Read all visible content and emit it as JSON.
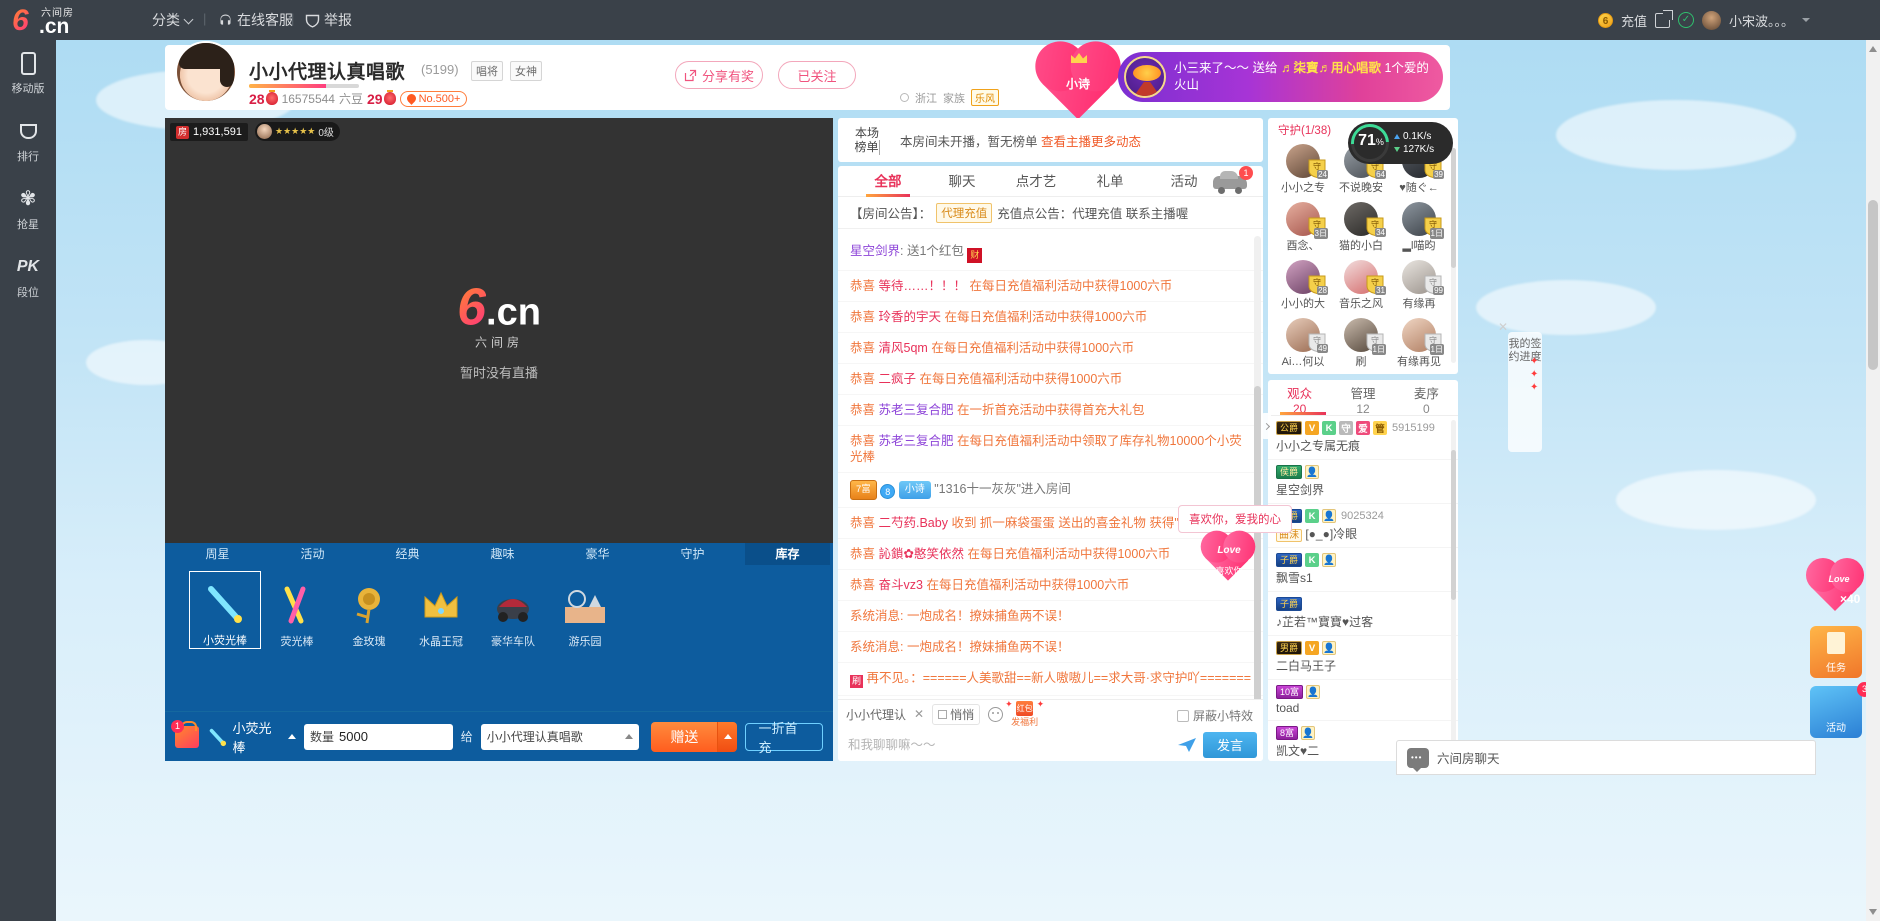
{
  "topnav": {
    "logo_main": "6",
    "logo_cn": ".cn",
    "logo_top": "六间房",
    "category": "分类",
    "support": "在线客服",
    "report": "举报",
    "recharge": "充值",
    "coin_glyph": "6",
    "username": "小宋波。。。"
  },
  "rail": [
    {
      "label": "移动版",
      "icon": "phone-icon"
    },
    {
      "label": "排行",
      "icon": "trophy-icon"
    },
    {
      "label": "抢星",
      "icon": "star-icon"
    },
    {
      "label": "段位",
      "icon": "pk-icon"
    }
  ],
  "anchor": {
    "name": "小小代理认真唱歌",
    "room_id": "(5199)",
    "tag1": "唱将",
    "tag2": "女神",
    "level_left": "28",
    "coins": "16575544",
    "coins_unit": "六豆",
    "level_right": "29",
    "rank_badge": "No.500+",
    "share_btn": "分享有奖",
    "follow_btn": "已关注",
    "location": "浙江",
    "family_label": "家族",
    "family_name": "乐风",
    "gift_heart_label": "小诗",
    "event_text_a": "小三来了～～ 送给 ",
    "event_text_b": "♬柒寶♬用心唱歌",
    "event_text_c": " 1个爱的火山"
  },
  "video": {
    "pop_count": "1,931,591",
    "pop_icon_text": "房",
    "level_pill": "0级",
    "watermark_6": "6",
    "watermark_cn": ".cn",
    "watermark_sub": "六间房",
    "offline_text": "暂时没有直播"
  },
  "giftbar": {
    "tabs": [
      "周星",
      "活动",
      "经典",
      "趣味",
      "豪华",
      "守护",
      "库存"
    ],
    "active_tab": "库存",
    "gifts": [
      {
        "name": "小荧光棒",
        "selected": true
      },
      {
        "name": "荧光棒",
        "selected": false
      },
      {
        "name": "金玫瑰",
        "selected": false
      },
      {
        "name": "水晶王冠",
        "selected": false
      },
      {
        "name": "豪华车队",
        "selected": false
      },
      {
        "name": "游乐园",
        "selected": false
      }
    ],
    "selected_gift": "小荧光棒",
    "bag_badge": "1",
    "qty_label": "数量",
    "qty_value": "5000",
    "to_label": "给",
    "to_value": "小小代理认真唱歌",
    "send_btn": "赠送",
    "recharge_btn": "一折首充"
  },
  "rank": {
    "left_line1": "本场",
    "left_line2": "榜单",
    "message": "本房间未开播，暂无榜单",
    "link": "查看主播更多动态"
  },
  "chat": {
    "tabs": [
      "全部",
      "聊天",
      "点才艺",
      "礼单",
      "活动"
    ],
    "active_tab": "全部",
    "car_badge": "1",
    "notice_prefix": "【房间公告】：",
    "notice_tag": "代理充值",
    "notice_text": "充值点公告：代理充值 联系主播喔",
    "messages": [
      {
        "type": "gift",
        "name": "星空剑界",
        "name_color": "purple",
        "text": ": 送1个红包",
        "badge": "财"
      },
      {
        "type": "congrats",
        "prefix": "恭喜",
        "name": "等待……！！！",
        "text": "在每日充值福利活动中获得1000六币"
      },
      {
        "type": "congrats",
        "prefix": "恭喜",
        "name": "玲香的宇天",
        "text": "在每日充值福利活动中获得1000六币"
      },
      {
        "type": "congrats",
        "prefix": "恭喜",
        "name": "清风5qm",
        "text": "在每日充值福利活动中获得1000六币"
      },
      {
        "type": "congrats",
        "prefix": "恭喜",
        "name": "二疯子",
        "text": "在每日充值福利活动中获得1000六币"
      },
      {
        "type": "congrats",
        "prefix": "恭喜",
        "name": "苏老三复合肥",
        "text": "在一折首充活动中获得首充大礼包"
      },
      {
        "type": "congrats",
        "prefix": "恭喜",
        "name": "苏老三复合肥",
        "text": "在每日充值福利活动中领取了库存礼物10000个小荧光棒"
      },
      {
        "type": "enter",
        "noble": "7富",
        "level": "8",
        "pill": "小诗",
        "text": "\"1316十一灰灰\"进入房间"
      },
      {
        "type": "congrats",
        "prefix": "恭喜",
        "name": "二芍药.Baby",
        "text": "收到 抓一麻袋蛋蛋 送出的喜金礼物 获得\"百花仙子\""
      },
      {
        "type": "congrats",
        "prefix": "恭喜",
        "name": "訫鎖✿憨笑依然",
        "text": "在每日充值福利活动中获得1000六币"
      },
      {
        "type": "congrats",
        "prefix": "恭喜",
        "name": "奋斗vz3",
        "text": "在每日充值福利活动中获得1000六币"
      },
      {
        "type": "system",
        "text": "系统消息: 一炮成名！撩妹捕鱼两不误！"
      },
      {
        "type": "system",
        "text": "系统消息: 一炮成名！撩妹捕鱼两不误！"
      },
      {
        "type": "badge_msg",
        "badge": "刷",
        "text": "再不见。：======人美歌甜==新人嗷嗷儿==求大哥·求守护吖======="
      }
    ],
    "input": {
      "sender": "小小代理认",
      "qq_label": "悄悄",
      "fuli_label": "发福利",
      "fuli_icon": "红包",
      "shield_label": "屏蔽小特效",
      "placeholder": "和我聊聊嘛～～",
      "post_btn": "发言"
    }
  },
  "guardians": {
    "title": "守护",
    "count": "(1/38)",
    "items": [
      {
        "name": "小小之专",
        "lvl": "24"
      },
      {
        "name": "不说晚安",
        "lvl": "64"
      },
      {
        "name": "♥随ぐ←",
        "lvl": "39"
      },
      {
        "name": "酉念、",
        "lvl": "3日"
      },
      {
        "name": "猫的小白",
        "lvl": "34"
      },
      {
        "name": "▂l喵昀",
        "lvl": "1日"
      },
      {
        "name": "小小的大",
        "lvl": "28"
      },
      {
        "name": "音乐之风",
        "lvl": "31"
      },
      {
        "name": "有缘再",
        "lvl": "99"
      },
      {
        "name": "Ai…何以",
        "lvl": "49"
      },
      {
        "name": "刷",
        "lvl": "1日"
      },
      {
        "name": "有缘再见",
        "lvl": "1日"
      }
    ]
  },
  "viewers": {
    "tabs": [
      {
        "label": "观众",
        "count": "20",
        "active": true
      },
      {
        "label": "管理",
        "count": "12",
        "active": false
      },
      {
        "label": "麦序",
        "count": "0",
        "active": false
      }
    ],
    "rows": [
      {
        "noble": "公爵",
        "noble_style": "noble",
        "badges": [
          "V",
          "K",
          "守",
          "爱",
          "管"
        ],
        "id": "5915199",
        "name": "小小之专属无痕"
      },
      {
        "noble": "侯爵",
        "noble_style": "noble",
        "badges": [
          "user"
        ],
        "id": "",
        "name": "星空剑界"
      },
      {
        "noble": "子爵",
        "noble_style": "blue",
        "badges": [
          "K",
          "user"
        ],
        "id": "9025324",
        "name": "[●_●]冷眼",
        "prefix_tag": "曲沬"
      },
      {
        "noble": "子爵",
        "noble_style": "blue",
        "badges": [
          "K",
          "user"
        ],
        "id": "",
        "name": "飘雪s1"
      },
      {
        "noble": "子爵",
        "noble_style": "blue",
        "badges": [],
        "id": "",
        "name": "♪芷若™寶寶♥过客"
      },
      {
        "noble": "男爵",
        "noble_style": "noble",
        "badges": [
          "V",
          "user"
        ],
        "id": "",
        "name": "二白马王子"
      },
      {
        "noble": "10富",
        "noble_style": "purple",
        "badges": [
          "user"
        ],
        "id": "",
        "name": "toad"
      },
      {
        "noble": "8富",
        "noble_style": "purple",
        "badges": [
          "user"
        ],
        "id": "",
        "name": "凯文♥二"
      },
      {
        "noble": "8富",
        "noble_style": "purple",
        "badges": [
          "user"
        ],
        "id": "",
        "name": ""
      }
    ]
  },
  "floating": {
    "net_percent": "71",
    "net_percent_sym": "%",
    "net_up": "0.1K/s",
    "net_down": "127K/s",
    "sign_text": "我的签约进度",
    "love_bubble": "喜欢你，爱我的心",
    "love_gift_line1": "Love",
    "love_gift_line2": "喜欢你",
    "right_float": [
      {
        "type": "heart",
        "label": "Love",
        "qty": "×40"
      },
      {
        "type": "box",
        "label": "任务"
      },
      {
        "type": "box2",
        "label": "活动",
        "badge": "3"
      }
    ],
    "chat_widget_title": "六间房聊天"
  }
}
